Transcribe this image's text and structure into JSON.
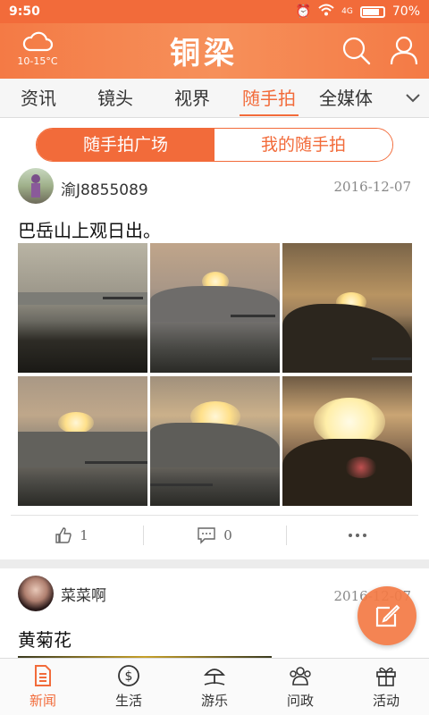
{
  "status_bar": {
    "time": "9:50",
    "signal_label": "4G",
    "battery": "70%"
  },
  "header": {
    "weather_temp": "10-15°C",
    "logo_text": "铜梁"
  },
  "nav": {
    "tabs": [
      {
        "label": "资讯"
      },
      {
        "label": "镜头"
      },
      {
        "label": "视界"
      },
      {
        "label": "随手拍"
      },
      {
        "label": "全媒体"
      }
    ],
    "active": "随手拍"
  },
  "segments": {
    "left": "随手拍广场",
    "right": "我的随手拍"
  },
  "posts": [
    {
      "username": "渝J8855089",
      "date": "2016-12-07",
      "text": "巴岳山上观日出。",
      "likes": "1",
      "comments": "0"
    },
    {
      "username": "菜菜啊",
      "date": "2016-12-07",
      "text": "黄菊花"
    }
  ],
  "bottom_nav": [
    {
      "label": "新闻"
    },
    {
      "label": "生活"
    },
    {
      "label": "游乐"
    },
    {
      "label": "问政"
    },
    {
      "label": "活动"
    }
  ],
  "colors": {
    "accent": "#f26b3a",
    "header_bg": "#f47a45"
  }
}
